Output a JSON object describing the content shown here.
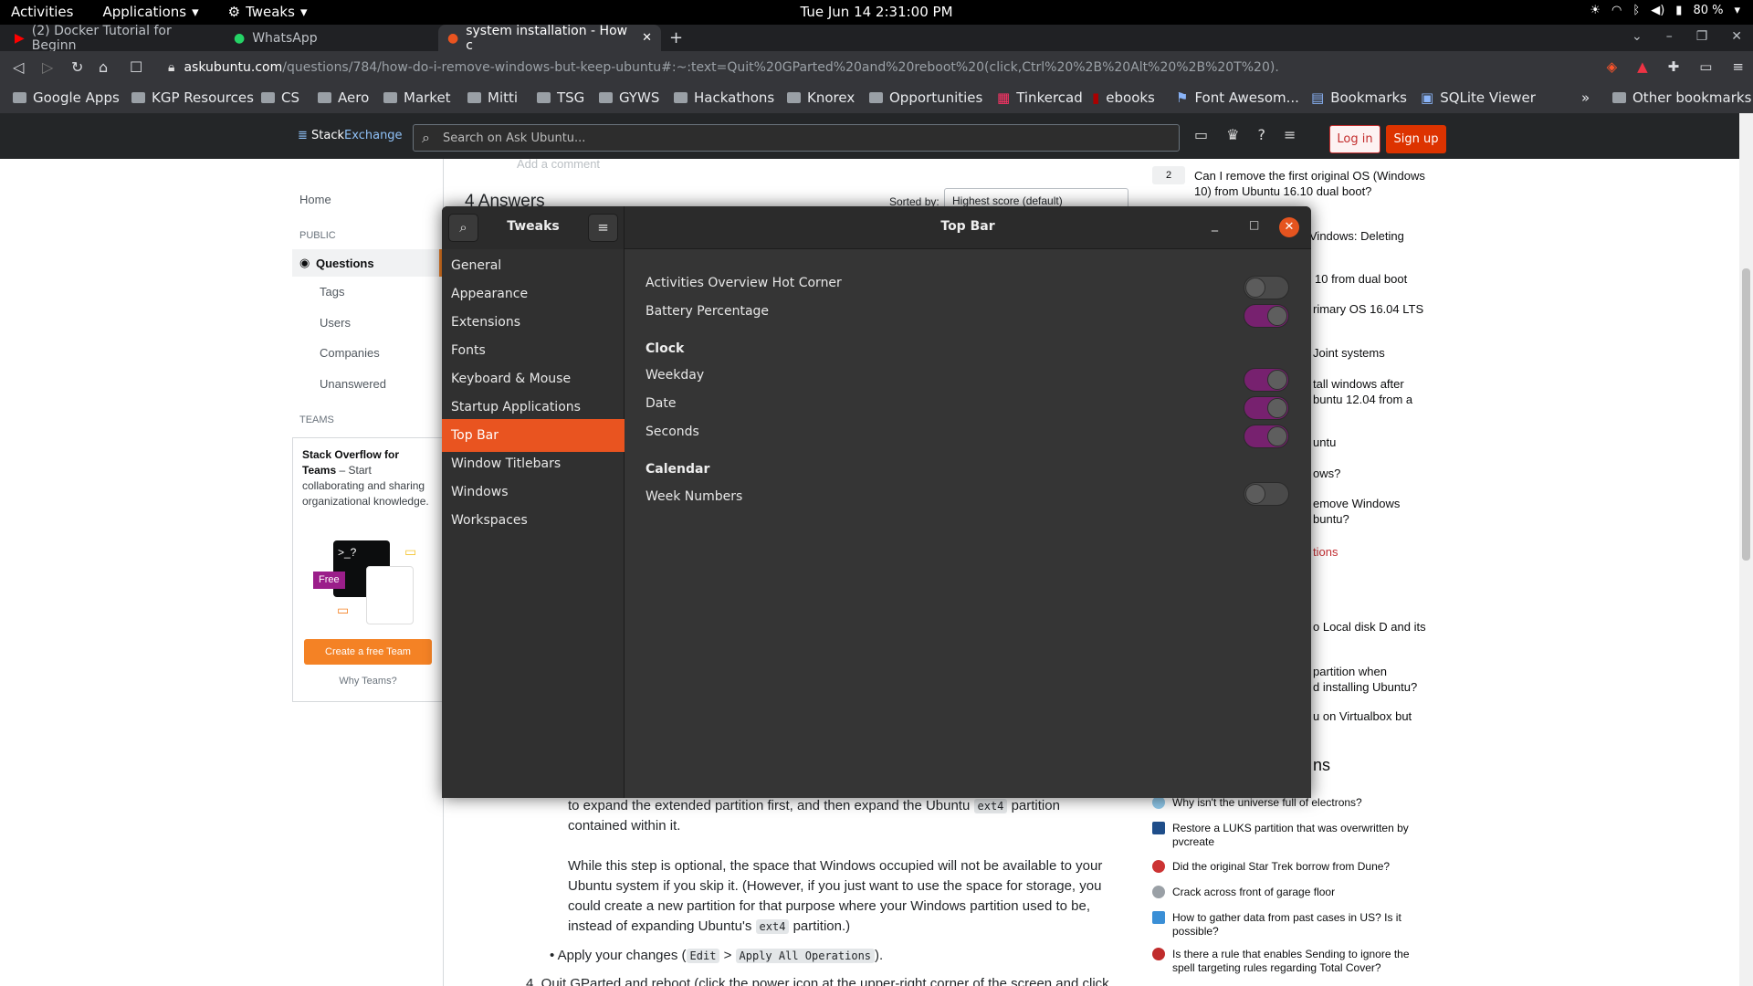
{
  "gnome": {
    "activities": "Activities",
    "applications": "Applications",
    "tweaks": "Tweaks",
    "clock": "Tue Jun 14  2:31:00 PM",
    "battery": "80 %"
  },
  "tabs": [
    {
      "title": "(2) Docker Tutorial for Beginn"
    },
    {
      "title": "WhatsApp"
    },
    {
      "title": "system installation - How c"
    }
  ],
  "url": {
    "host": "askubuntu.com",
    "path": "/questions/784/how-do-i-remove-windows-but-keep-ubuntu#:~:text=Quit%20GParted%20and%20reboot%20(click,Ctrl%20%2B%20Alt%20%2B%20T%20)."
  },
  "bookmarks": [
    "Google Apps",
    "KGP Resources",
    "CS",
    "Aero",
    "Market",
    "Mitti",
    "TSG",
    "GYWS",
    "Hackathons",
    "Knorex",
    "Opportunities",
    "Tinkercad",
    "ebooks",
    "Font Awesom...",
    "Bookmarks",
    "SQLite Viewer",
    "»",
    "Other bookmarks"
  ],
  "se": {
    "logo_a": "Stack",
    "logo_b": "Exchange",
    "search_placeholder": "Search on Ask Ubuntu...",
    "login": "Log in",
    "signup": "Sign up"
  },
  "leftnav": {
    "home": "Home",
    "public": "PUBLIC",
    "questions": "Questions",
    "tags": "Tags",
    "users": "Users",
    "companies": "Companies",
    "unanswered": "Unanswered",
    "teams": "TEAMS",
    "teams_title": "Stack Overflow for Teams",
    "teams_text": " – Start collaborating and sharing organizational knowledge.",
    "free": "Free",
    "create_team": "Create a free Team",
    "why_teams": "Why Teams?"
  },
  "main": {
    "add_comment": "Add a comment",
    "answers_heading": "4 Answers",
    "sorted_by": "Sorted by:",
    "sort_value": "Highest score (default)",
    "p1a": "to expand the extended partition first, and then expand the Ubuntu",
    "p1code": "ext4",
    "p1b": "partition contained within it.",
    "p2": "While this step is optional, the space that Windows occupied will not be available to your Ubuntu system if you skip it. (However, if you just want to use the space for storage, you could create a new partition for that purpose where your Windows partition used to be, instead of expanding Ubuntu's",
    "p2code": "ext4",
    "p2end": "partition.)",
    "apply_a": "Apply your changes (",
    "apply_edit": "Edit",
    "apply_gt": ">",
    "apply_ops": "Apply All Operations",
    "apply_b": ").",
    "step4": "4. Quit GParted and reboot (click the power icon at the upper-right corner of the screen and click"
  },
  "right": {
    "count": "2",
    "related": [
      "Can I remove the first original OS (Windows 10) from Ubuntu 16.10 dual boot?",
      "Vindows: Deleting",
      "10 from dual boot",
      "rimary OS 16.04 LTS",
      "Joint systems",
      "tall windows after",
      "buntu 12.04 from a",
      "untu",
      "ows?",
      "emove Windows",
      "buntu?",
      "tions",
      "o Local disk D and its",
      "partition when",
      "d installing Ubuntu?",
      "u on Virtualbox but",
      "ns"
    ],
    "hot": [
      "Why isn't the universe full of electrons?",
      "Restore a LUKS partition that was overwritten by pvcreate",
      "Did the original Star Trek borrow from Dune?",
      "Crack across front of garage floor",
      "How to gather data from past cases in US? Is it possible?",
      "Is there a rule that enables Sending to ignore the spell targeting rules regarding Total Cover?"
    ]
  },
  "tweaks": {
    "app_title": "Tweaks",
    "page_title": "Top Bar",
    "nav": [
      "General",
      "Appearance",
      "Extensions",
      "Fonts",
      "Keyboard & Mouse",
      "Startup Applications",
      "Top Bar",
      "Window Titlebars",
      "Windows",
      "Workspaces"
    ],
    "active_nav": "Top Bar",
    "settings": {
      "hot_corner": {
        "label": "Activities Overview Hot Corner",
        "on": false
      },
      "battery": {
        "label": "Battery Percentage",
        "on": true
      },
      "clock_heading": "Clock",
      "weekday": {
        "label": "Weekday",
        "on": true
      },
      "date": {
        "label": "Date",
        "on": true
      },
      "seconds": {
        "label": "Seconds",
        "on": true
      },
      "calendar_heading": "Calendar",
      "week_numbers": {
        "label": "Week Numbers",
        "on": false
      }
    }
  },
  "colors": {
    "accent": "#e95420",
    "toggle_on": "#77216f",
    "se_red": "#d30"
  }
}
